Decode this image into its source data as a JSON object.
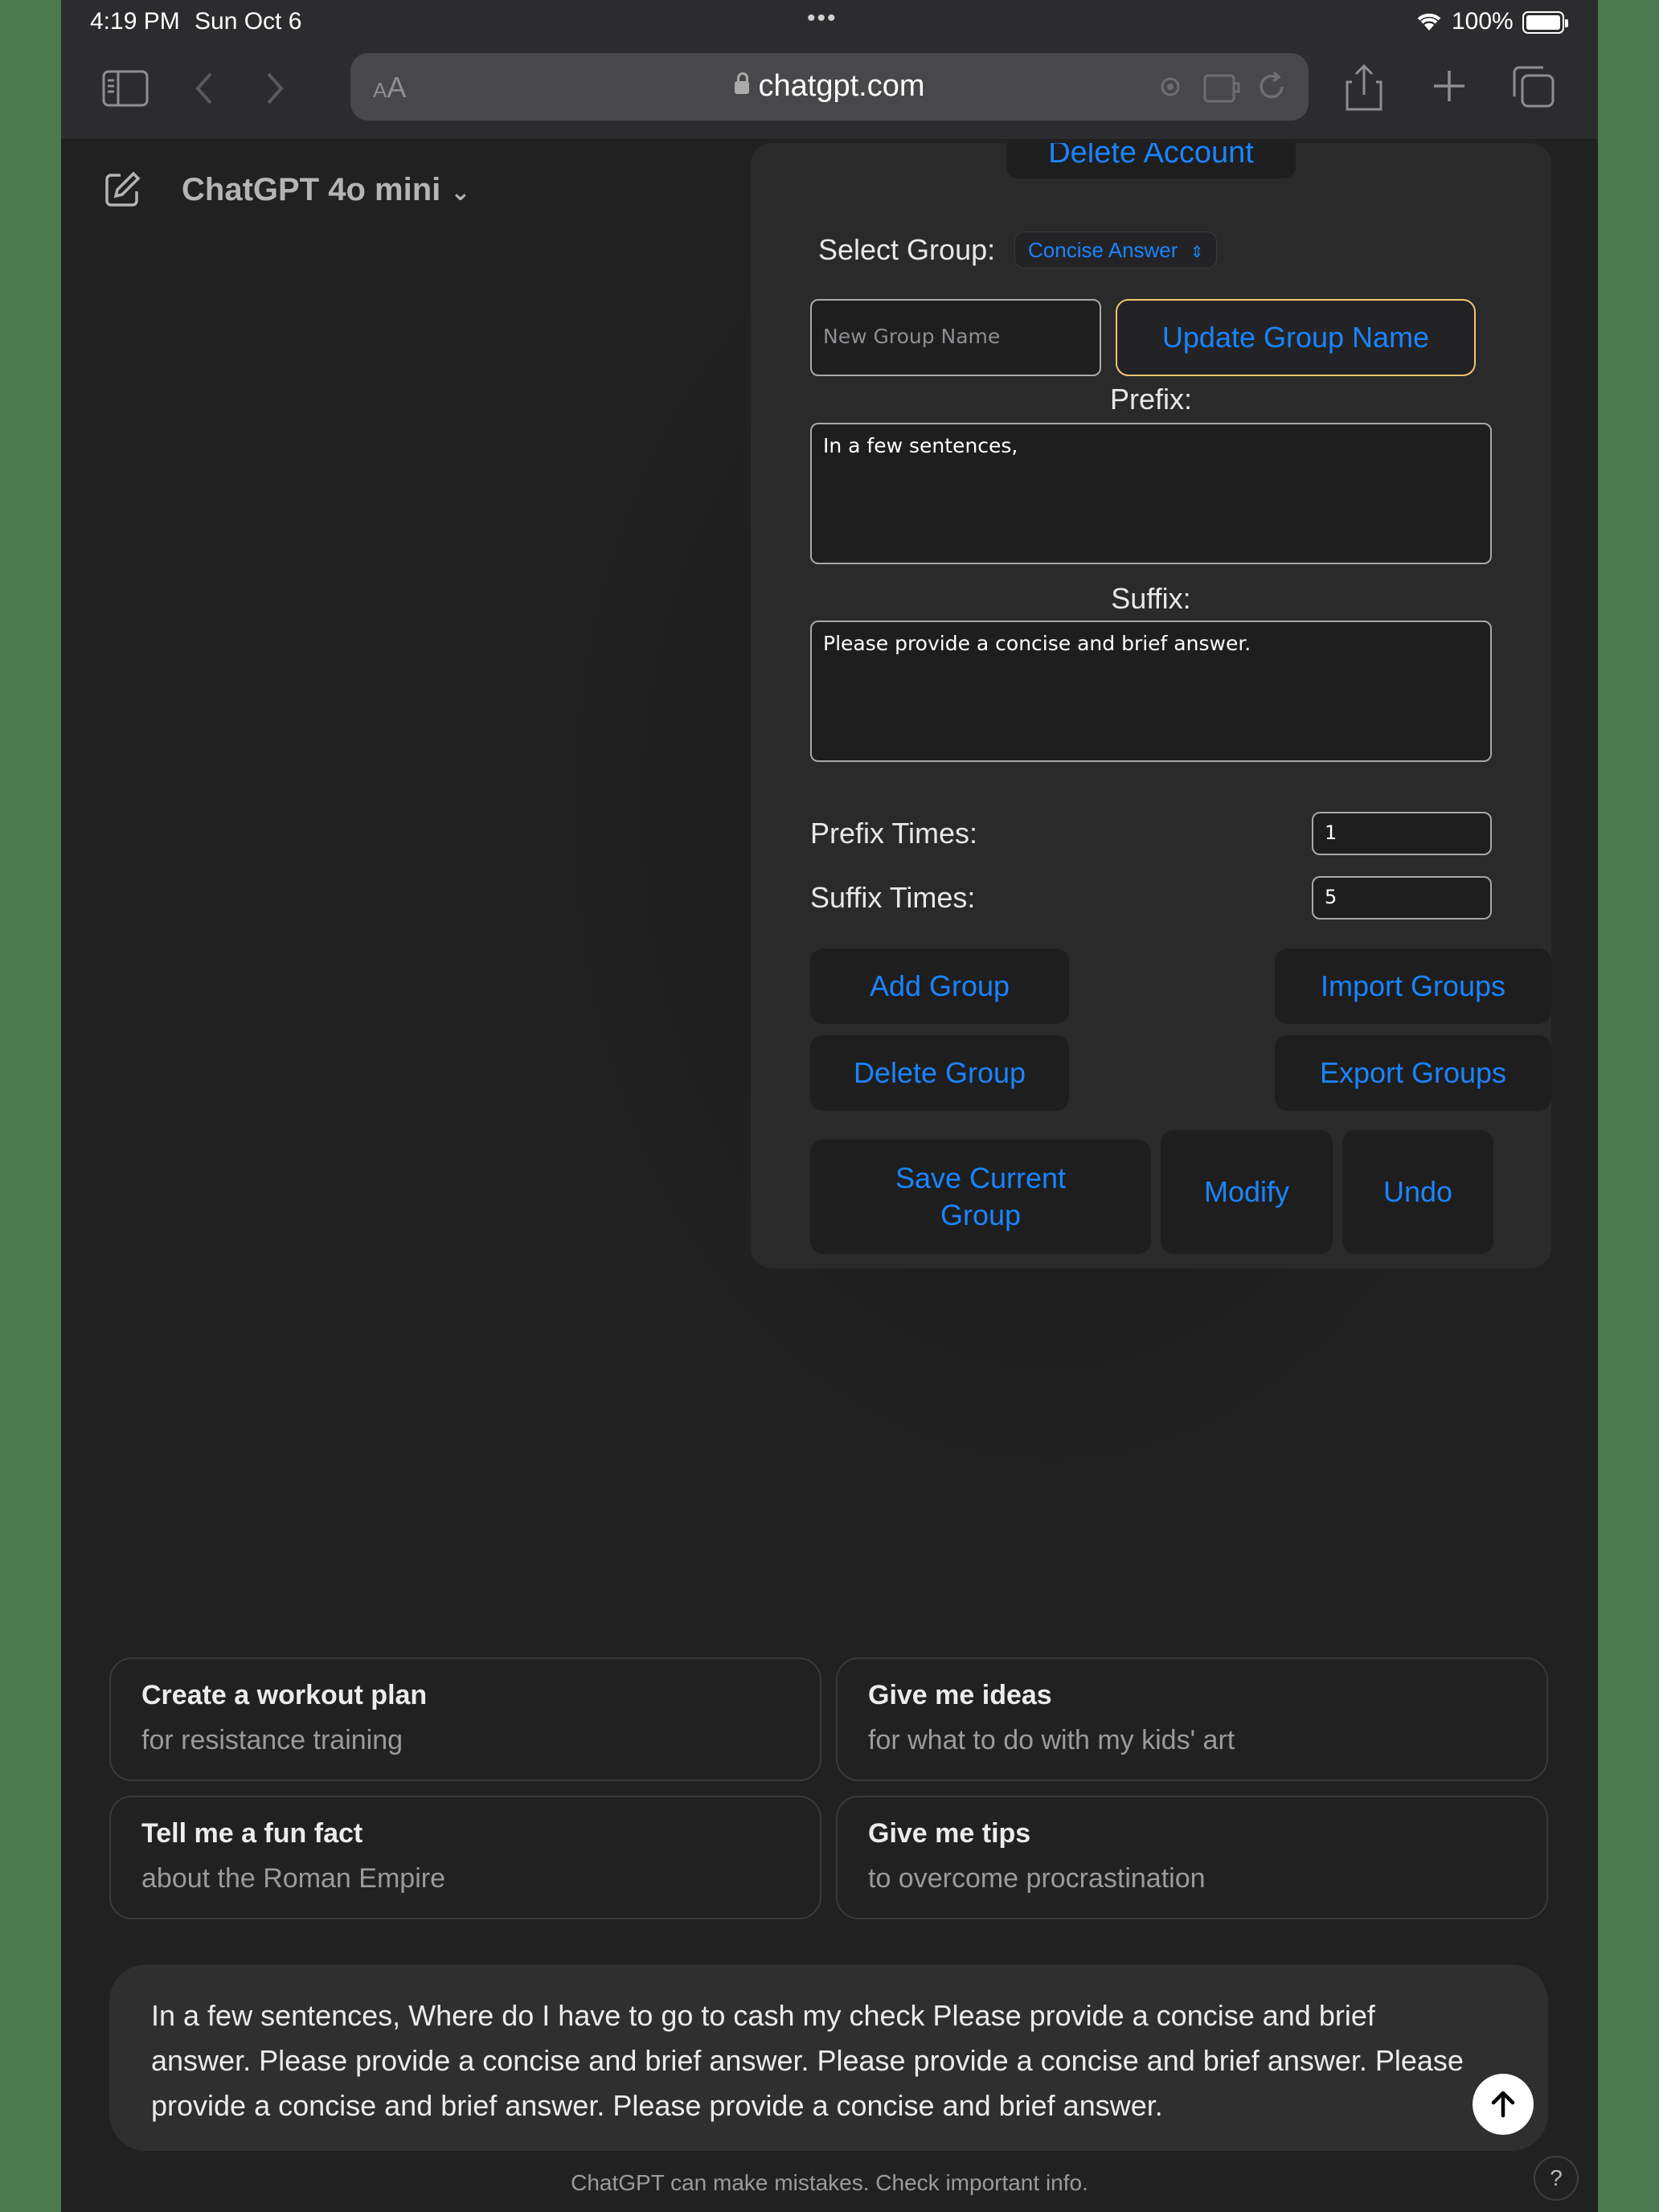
{
  "status": {
    "time": "4:19 PM",
    "date": "Sun Oct 6",
    "battery": "100%"
  },
  "browser": {
    "aa_label": "AA",
    "url": "chatgpt.com"
  },
  "header": {
    "model": "ChatGPT 4o mini"
  },
  "panel": {
    "delete_account_label": "Delete Account",
    "select_group_label": "Select Group:",
    "selected_group": "Concise Answer",
    "new_group_placeholder": "New Group Name",
    "update_group_label": "Update Group Name",
    "prefix_label": "Prefix:",
    "prefix_value": "In a few sentences,",
    "suffix_label": "Suffix:",
    "suffix_value": "Please provide a concise and brief answer.",
    "prefix_times_label": "Prefix Times:",
    "prefix_times_value": "1",
    "suffix_times_label": "Suffix Times:",
    "suffix_times_value": "5",
    "add_group_label": "Add Group",
    "import_groups_label": "Import Groups",
    "delete_group_label": "Delete Group",
    "export_groups_label": "Export Groups",
    "save_current_line1": "Save Current",
    "save_current_line2": "Group",
    "modify_label": "Modify",
    "undo_label": "Undo"
  },
  "suggestions": [
    {
      "title": "Create a workout plan",
      "subtitle": "for resistance training"
    },
    {
      "title": "Give me ideas",
      "subtitle": "for what to do with my kids' art"
    },
    {
      "title": "Tell me a fun fact",
      "subtitle": "about the Roman Empire"
    },
    {
      "title": "Give me tips",
      "subtitle": "to overcome procrastination"
    }
  ],
  "composer": {
    "text": "In a few sentences, Where do I have to go to cash my check Please provide a concise and brief answer. Please provide a concise and brief answer. Please provide a concise and brief answer. Please provide a concise and brief answer. Please provide a concise and brief answer."
  },
  "footer": {
    "disclaimer": "ChatGPT can make mistakes. Check important info.",
    "help_label": "?"
  },
  "colors": {
    "accent": "#1a84ff",
    "outline": "#f5c470",
    "background": "#212121"
  }
}
